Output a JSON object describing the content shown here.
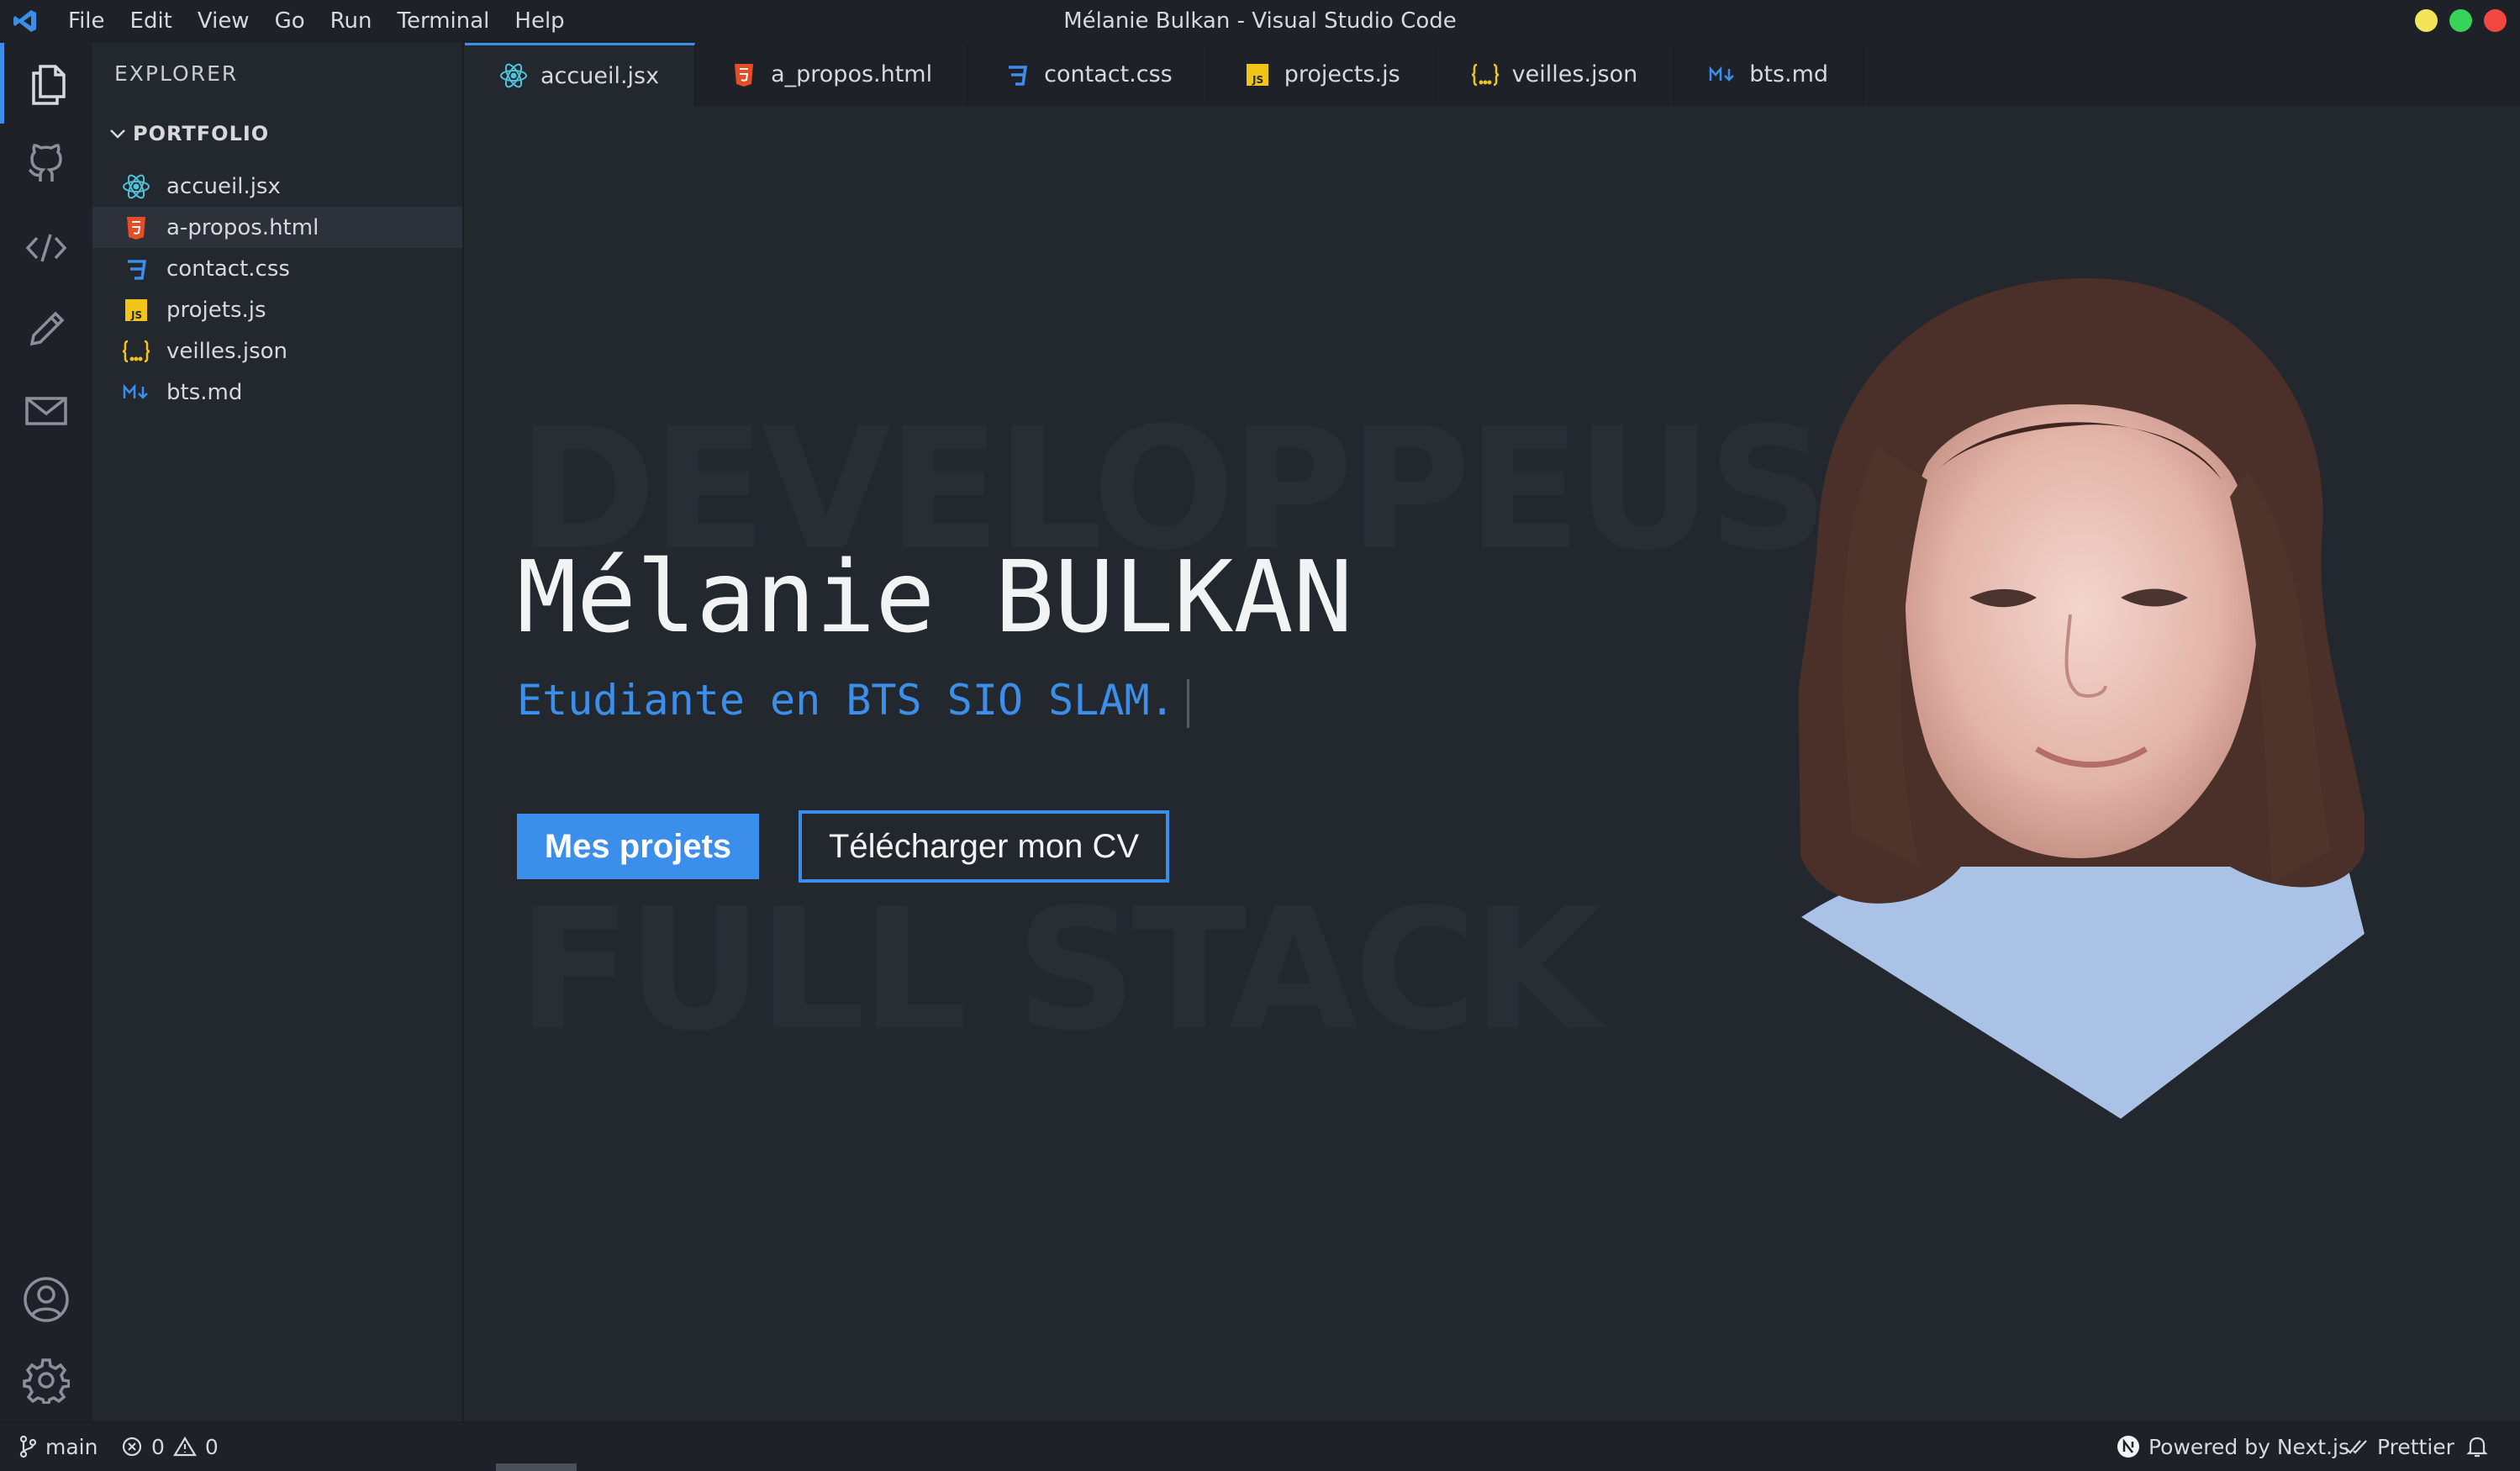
{
  "window": {
    "title": "Mélanie Bulkan - Visual Studio Code",
    "menu": [
      "File",
      "Edit",
      "View",
      "Go",
      "Run",
      "Terminal",
      "Help"
    ],
    "controls": {
      "minimize": "#f5e35a",
      "maximize": "#37d45a",
      "close": "#f4473f"
    }
  },
  "activity": [
    "files-icon",
    "github-icon",
    "code-icon",
    "pencil-icon",
    "mail-icon",
    "account-icon",
    "settings-icon"
  ],
  "explorer": {
    "title": "EXPLORER",
    "folder": "PORTFOLIO",
    "files": [
      {
        "name": "accueil.jsx",
        "icon": "react-icon"
      },
      {
        "name": "a-propos.html",
        "icon": "html-icon"
      },
      {
        "name": "contact.css",
        "icon": "css-icon"
      },
      {
        "name": "projets.js",
        "icon": "js-icon"
      },
      {
        "name": "veilles.json",
        "icon": "json-icon"
      },
      {
        "name": "bts.md",
        "icon": "markdown-icon"
      }
    ]
  },
  "tabs": [
    {
      "label": "accueil.jsx",
      "active": true
    },
    {
      "label": "a_propos.html"
    },
    {
      "label": "contact.css"
    },
    {
      "label": "projects.js"
    },
    {
      "label": "veilles.json"
    },
    {
      "label": "bts.md"
    }
  ],
  "hero": {
    "bg_word_1": "DEVELOPPEUSE",
    "bg_word_2": "FULL STACK",
    "name": "Mélanie BULKAN",
    "subtitle": "Etudiante en BTS SIO SLAM.",
    "primary_button": "Mes projets",
    "secondary_button": "Télécharger mon CV",
    "portrait": "portrait-photo"
  },
  "status": {
    "branch": "main",
    "errors": "0",
    "warnings": "0",
    "powered": "Powered by Next.js",
    "formatter": "Prettier"
  },
  "colors": {
    "accent": "#3b8eea",
    "bg": "#23272e",
    "chrome": "#1e2228"
  }
}
